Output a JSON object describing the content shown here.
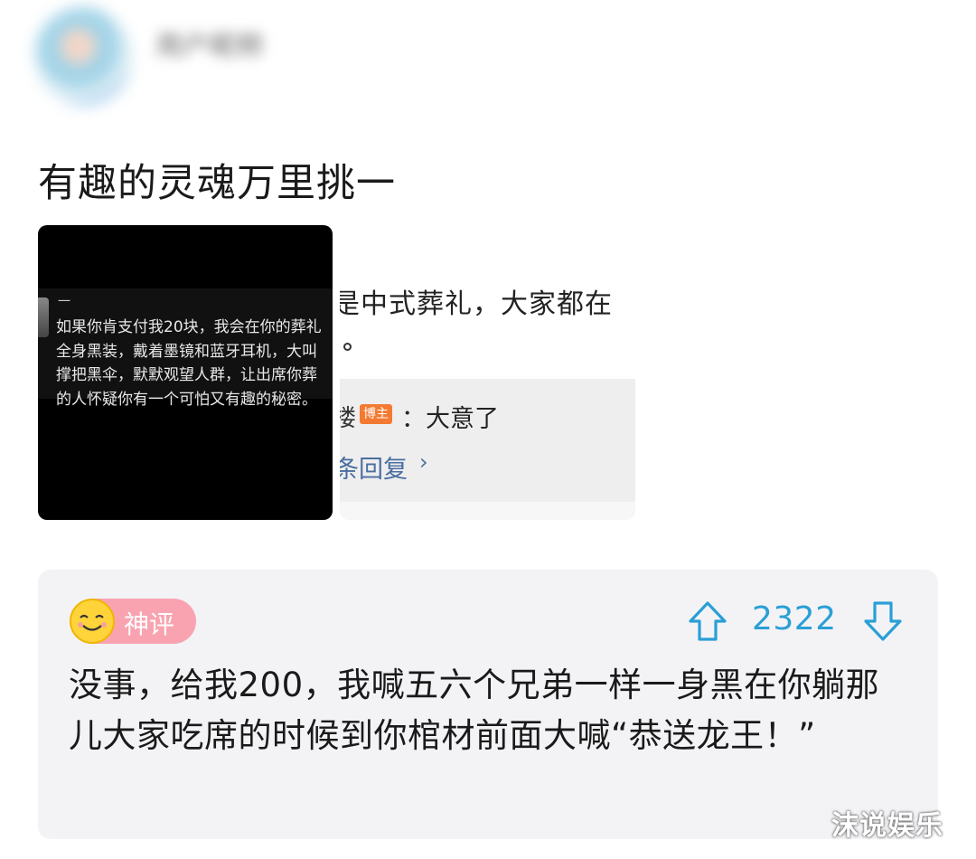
{
  "header": {
    "username": "用户昵称",
    "meta": "",
    "avatar_icon": "avatar-icon"
  },
  "post": {
    "text": "有趣的灵魂万里挑一"
  },
  "images": {
    "left": {
      "dash": "一",
      "quote_lines": [
        "如果你肯支付我20块，我会在你的葬礼",
        "全身黑装，戴着墨镜和蓝牙耳机，大叫",
        "撑把黑伞，默默观望人群，让出席你葬",
        "的人怀疑你有一个可怕又有趣的秘密。"
      ]
    },
    "right": {
      "line1": "是中式葬礼，大家都在",
      "badge": "博主",
      "reply_prefix": "楼",
      "reply_text": "：大意了",
      "more_replies": "条回复",
      "chevron": "›"
    }
  },
  "comment": {
    "badge_label": "神评",
    "badge_icon": "smiley-icon",
    "vote_count": "2322",
    "text": "没事，给我200，我喊五六个兄弟一样一身黑在你躺那儿大家吃席的时候到你棺材前面大喊“恭送龙王！”",
    "accent_color": "#2a9fd6",
    "badge_color": "#f9a3b1"
  },
  "watermark": "沫说娱乐"
}
